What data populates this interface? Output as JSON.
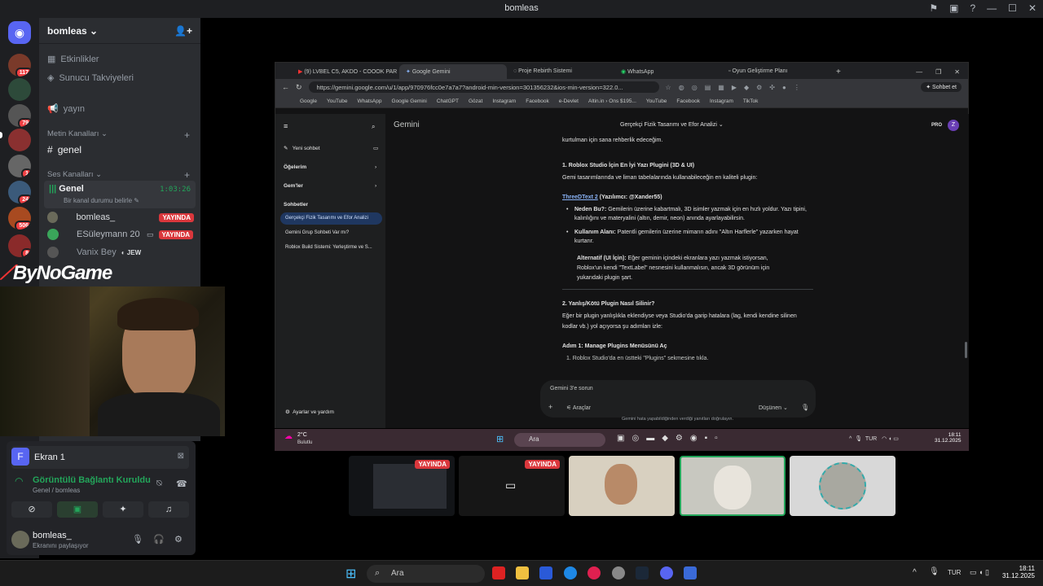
{
  "window_title": "bomleas",
  "server": {
    "name": "bomleas"
  },
  "rail_badges": [
    "117",
    "79",
    "1",
    "24",
    "506",
    "8"
  ],
  "channels": {
    "events": "Etkinlikler",
    "boosts": "Sunucu Takviyeleri",
    "yayin": "yayın",
    "text_category": "Metin Kanalları",
    "text_channel": "genel",
    "voice_category": "Ses Kanalları",
    "voice_channel": "Genel",
    "voice_timer": "1:03:26",
    "status_placeholder": "Bir kanal durumu belirle",
    "members": [
      {
        "name": "bomleas_",
        "live": "YAYINDA"
      },
      {
        "name": "ESüleymann 20",
        "live": "YAYINDA"
      },
      {
        "name": "Vanix Bey",
        "tag": "JEW"
      }
    ]
  },
  "overlay_brand": "ByNoGame",
  "voice_panel": {
    "screen_label": "Ekran 1",
    "screen_initial": "F",
    "connection": "Görüntülü Bağlantı Kuruldu",
    "location": "Genel / bomleas",
    "user": "bomleas_",
    "user_status": "Ekranını paylaşıyor"
  },
  "browser": {
    "tabs": [
      "(9) LVBEL C5, AKDO - COOOK PAR",
      "Google Gemini",
      "Proje Rebirth Sistemi",
      "WhatsApp",
      "Oyun Geliştirme Planı"
    ],
    "url": "https://gemini.google.com/u/1/app/970976fcc0e7a7a7?android-min-version=301356232&ios-min-version=322.0...",
    "share_label": "Sohbet et",
    "bookmarks": [
      "Google",
      "YouTube",
      "WhatsApp",
      "Google Gemini",
      "ChatGPT",
      "Gözat",
      "Instagram",
      "Facebook",
      "e-Devlet",
      "Altin.in › Ons $195...",
      "YouTube",
      "Facebook",
      "Instagram",
      "TikTok"
    ]
  },
  "gemini": {
    "brand": "Gemini",
    "new_chat": "Yeni sohbet",
    "items": "Öğelerim",
    "gems": "Gem'ler",
    "chats_title": "Sohbetler",
    "chats": [
      "Gerçekçi Fizik Tasarımı ve Efor Analizi",
      "Gemini Grup Sohbeti Var mı?",
      "Roblox Build Sistemi: Yerleştirme ve S..."
    ],
    "settings": "Ayarlar ve yardım",
    "conversation_title": "Gerçekçi Fizik Tasarımı ve Efor Analizi",
    "pro": "PRO",
    "avatar": "Z",
    "content": {
      "line0": "kurtulman için sana rehberlik edeceğim.",
      "h1": "1. Roblox Studio İçin En İyi Yazı Plugini (3D & UI)",
      "p1": "Gemi tasarımlarında ve liman tabelalarında kullanabileceğin en kaliteli plugin:",
      "link": "ThreeDText 2",
      "link_suffix": " (Yazılımcı: @Xander55)",
      "b1_bold": "Neden Bu?:",
      "b1": " Gemilerin üzerine kabartmalı, 3D isimler yazmak için en hızlı yoldur. Yazı tipini,",
      "b1b": "kalınlığını ve materyalini (altın, demir, neon) anında ayarlayabilirsin.",
      "b2_bold": "Kullanım Alanı:",
      "b2": " Patentli gemilerin üzerine mimarın adını \"Altın Harflerle\" yazarken hayat",
      "b2b": "kurtarır.",
      "alt_bold": "Alternatif (UI İçin):",
      "alt": " Eğer geminin içindeki ekranlara yazı yazmak istiyorsan,",
      "alt2": "Roblox'un kendi \"TextLabel\" nesnesini kullanmalısın, ancak 3D görünüm için",
      "alt3": "yukarıdaki plugin şart.",
      "h2": "2. Yanlış/Kötü Plugin Nasıl Silinir?",
      "p2": "Eğer bir plugin yanlışlıkla eklendiyse veya Studio'da garip hatalara (lag, kendi kendine silinen",
      "p2b": "kodlar vb.) yol açıyorsa şu adımları izle:",
      "h3": "Adım 1: Manage Plugins Menüsünü Aç",
      "step1": "1.  Roblox Studio'da en üstteki \"Plugins\" sekmesine tıkla."
    },
    "prompt_placeholder": "Gemini 3'e sorun",
    "tools": "Araçlar",
    "mode": "Düşünen",
    "disclaimer": "Gemini hata yapabildiğinden verdiği yanıtları doğrulayın."
  },
  "inner_taskbar": {
    "weather_temp": "2°C",
    "weather_desc": "Bulutlu",
    "search": "Ara",
    "lang": "TUR",
    "time": "18:11",
    "date": "31.12.2025"
  },
  "stream_tiles": [
    {
      "live": "YAYINDA"
    },
    {
      "live": "YAYINDA"
    }
  ],
  "taskbar": {
    "search": "Ara",
    "lang": "TUR",
    "time": "18:11",
    "date": "31.12.2025"
  }
}
